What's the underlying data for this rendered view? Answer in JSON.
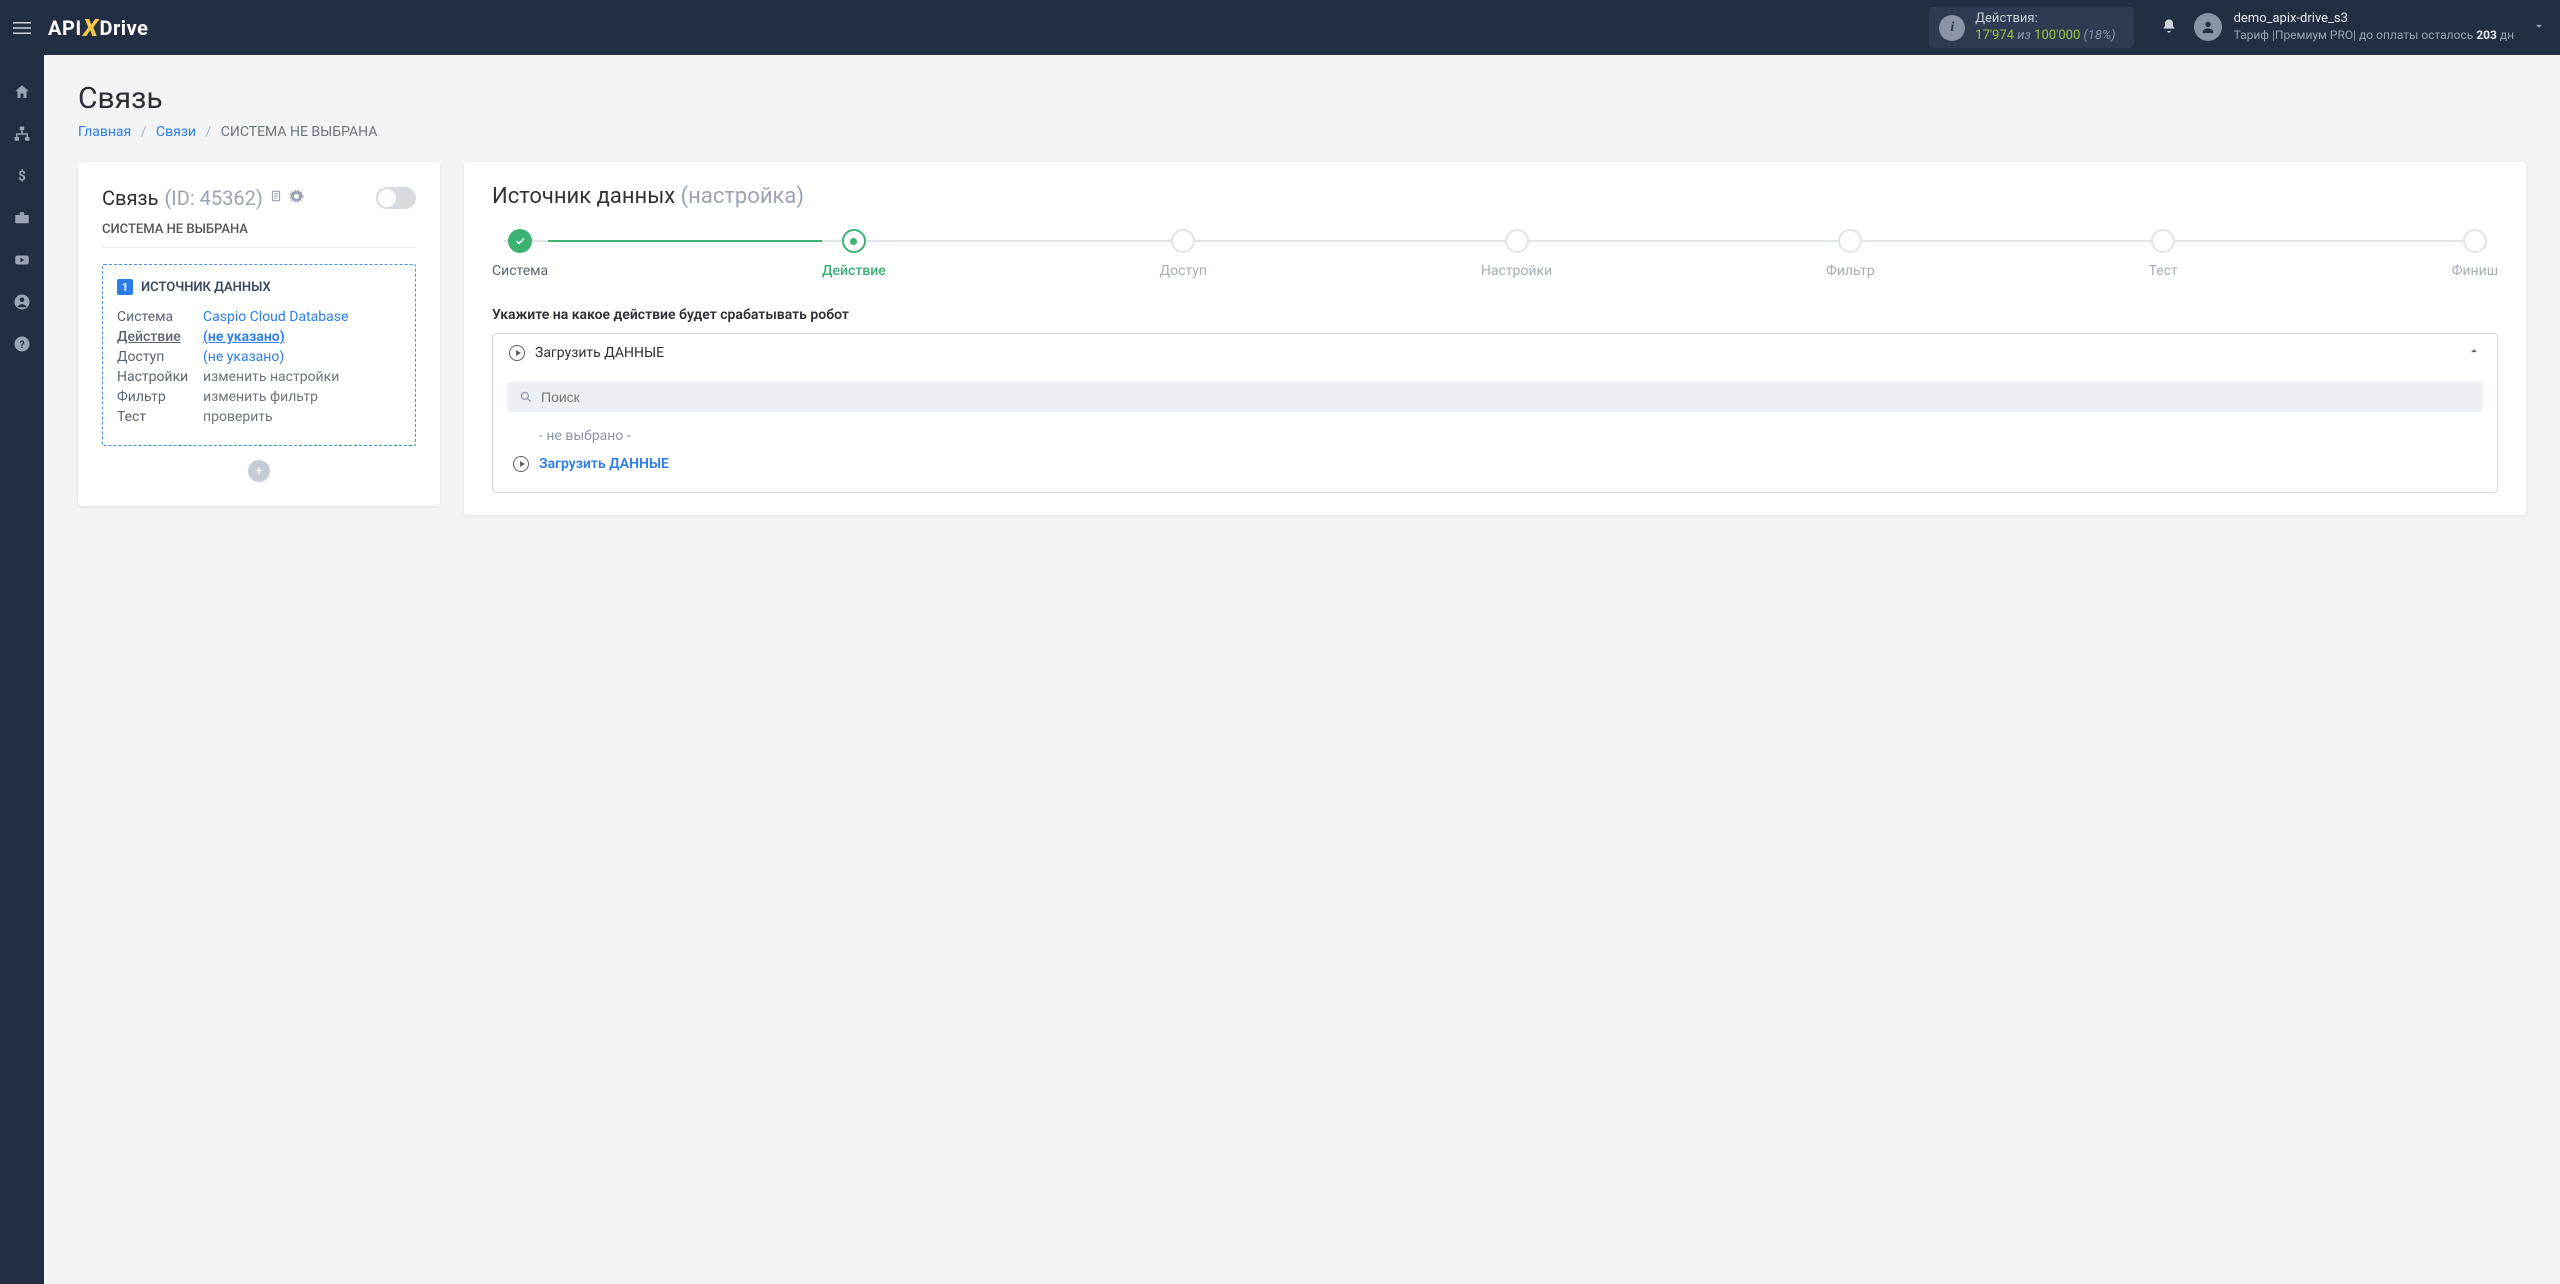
{
  "header": {
    "logo_pre": "API",
    "logo_x": "X",
    "logo_post": "Drive",
    "actions_label": "Действия:",
    "actions_used": "17'974",
    "actions_of": " из ",
    "actions_total": "100'000",
    "actions_pct": " (18%)",
    "username": "demo_apix-drive_s3",
    "tariff_pre": "Тариф |Премиум PRO| до оплаты осталось ",
    "tariff_days": "203",
    "tariff_post": " дн"
  },
  "page": {
    "title": "Связь",
    "breadcrumb_home": "Главная",
    "breadcrumb_links": "Связи",
    "breadcrumb_current": "СИСТЕМА НЕ ВЫБРАНА"
  },
  "left": {
    "title": "Связь",
    "id": "(ID: 45362)",
    "subtitle": "СИСТЕМА НЕ ВЫБРАНА",
    "source_heading": "ИСТОЧНИК ДАННЫХ",
    "rows": {
      "system_k": "Система",
      "system_v": "Caspio Cloud Database",
      "action_k": "Действие",
      "action_v": "(не указано)",
      "access_k": "Доступ",
      "access_v": "(не указано)",
      "settings_k": "Настройки",
      "settings_v": "изменить настройки",
      "filter_k": "Фильтр",
      "filter_v": "изменить фильтр",
      "test_k": "Тест",
      "test_v": "проверить"
    }
  },
  "right": {
    "title_main": "Источник данных ",
    "title_sub": "(настройка)",
    "steps": [
      "Система",
      "Действие",
      "Доступ",
      "Настройки",
      "Фильтр",
      "Тест",
      "Финиш"
    ],
    "field_label": "Укажите на какое действие будет срабатывать робот",
    "select_value": "Загрузить ДАННЫЕ",
    "search_placeholder": "Поиск",
    "opt_none": "- не выбрано -",
    "opt_action": "Загрузить ДАННЫЕ"
  }
}
